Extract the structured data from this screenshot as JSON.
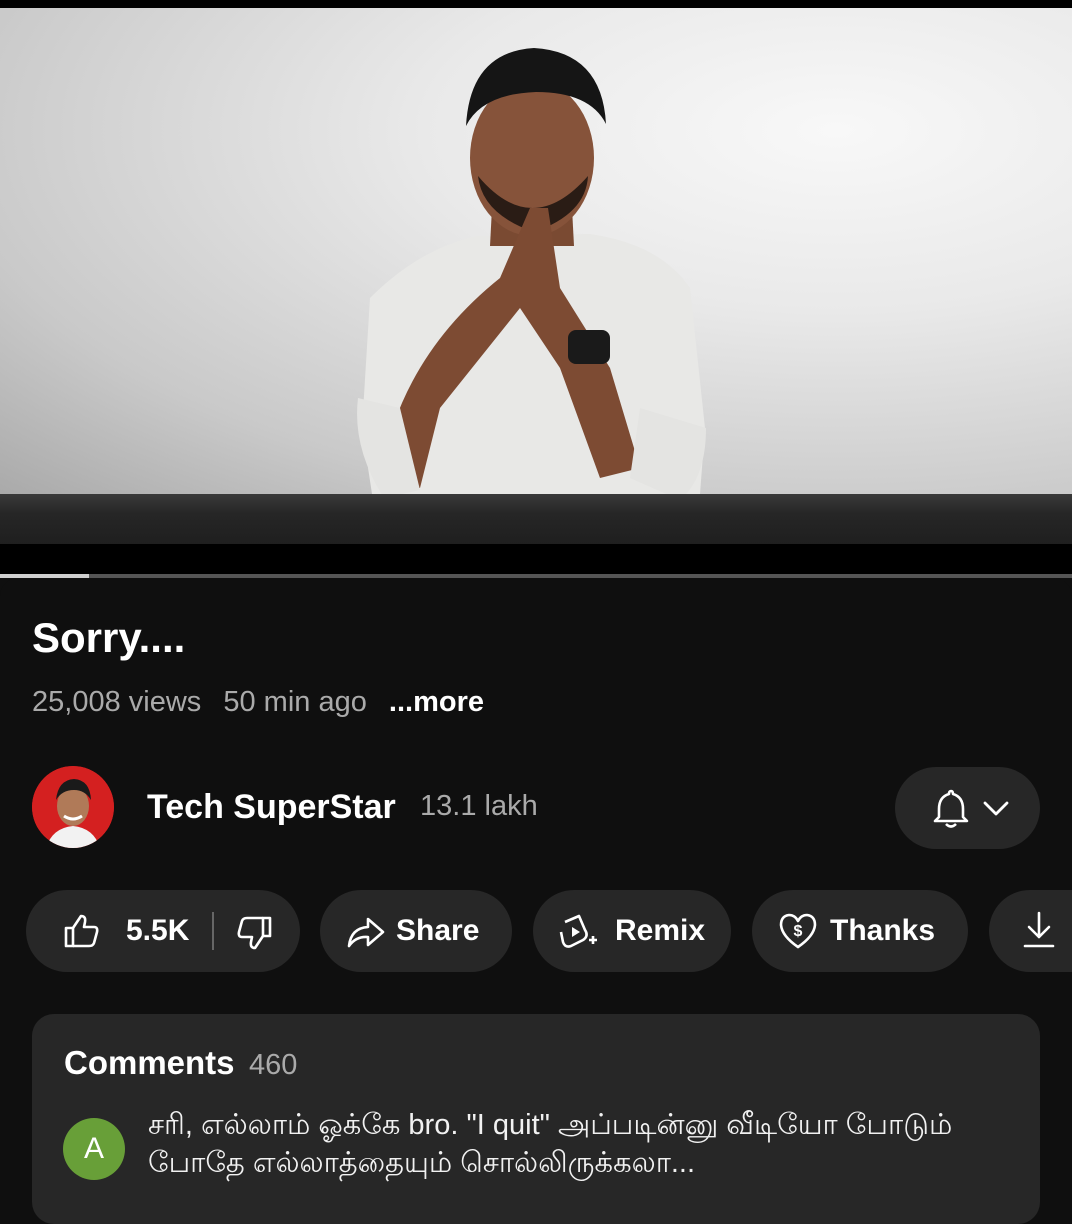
{
  "video": {
    "progress_fraction": 0.083
  },
  "title": "Sorry....",
  "meta": {
    "views": "25,008 views",
    "age": "50 min ago",
    "more": "...more"
  },
  "channel": {
    "name": "Tech SuperStar",
    "subscribers": "13.1 lakh",
    "avatar_color": "#d42020"
  },
  "actions": {
    "like_count": "5.5K",
    "share": "Share",
    "remix": "Remix",
    "thanks": "Thanks"
  },
  "comments": {
    "title": "Comments",
    "count": "460",
    "first": {
      "avatar_letter": "A",
      "avatar_color": "#689f38",
      "text": "சரி, எல்லாம் ஓக்கே bro. \"I quit\" அப்படின்னு வீடியோ போடும் போதே எல்லாத்தையும் சொல்லிருக்கலா..."
    }
  },
  "icons": [
    "like-icon",
    "dislike-icon",
    "share-icon",
    "remix-icon",
    "thanks-icon",
    "download-icon",
    "bell-icon",
    "chevron-down-icon"
  ],
  "colors": {
    "background": "#0f0f0f",
    "pill": "#272727",
    "muted_text": "#aaaaaa"
  }
}
